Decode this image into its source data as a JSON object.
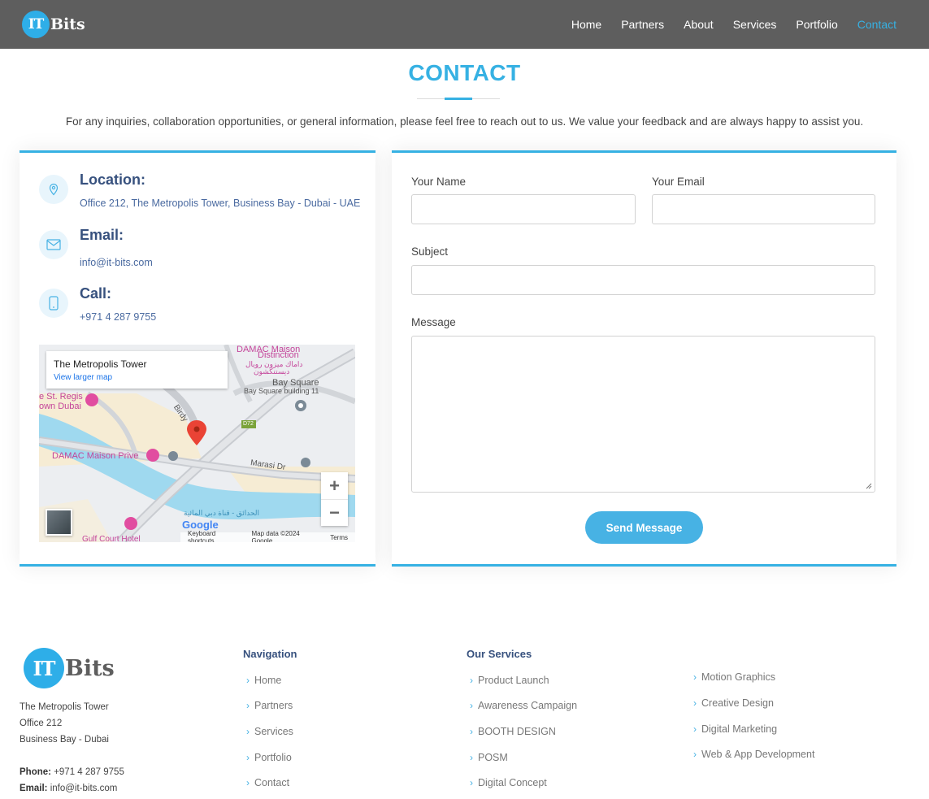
{
  "header": {
    "logo_badge": "IT",
    "logo_word": "Bits",
    "nav": [
      {
        "label": "Home"
      },
      {
        "label": "Partners"
      },
      {
        "label": "About"
      },
      {
        "label": "Services"
      },
      {
        "label": "Portfolio"
      },
      {
        "label": "Contact",
        "active": true
      }
    ]
  },
  "section": {
    "title": "CONTACT",
    "intro": "For any inquiries, collaboration opportunities, or general information, please feel free to reach out to us. We value your feedback and are always happy to assist you."
  },
  "info": {
    "location_title": "Location:",
    "location_text": "Office 212, The Metropolis Tower, Business Bay - Dubai - UAE",
    "email_title": "Email:",
    "email_text": "info@it-bits.com",
    "call_title": "Call:",
    "call_text": "+971 4 287 9755"
  },
  "map": {
    "place_title": "The Metropolis Tower",
    "larger_map": "View larger map",
    "labels": {
      "damac_distinction": "DAMAC Maison",
      "damac_distinction_2": "Distinction",
      "damac_arabic": "داماك ميزون رويال",
      "damac_arabic_2": "ديستنكشون",
      "bay_square": "Bay Square",
      "bay_square_building": "Bay Square building 11",
      "st_regis": "e St. Regis",
      "st_regis_2": "own Dubai",
      "birdy": "Birdy",
      "d72": "D72",
      "damac_prive": "DAMAC Maison Prive",
      "marasi": "Marasi Dr",
      "arabic_canal": "الحدائق - قناة دبي المائية",
      "gulf_court": "Gulf Court Hotel"
    },
    "zoom_in": "+",
    "zoom_out": "−",
    "google": "Google",
    "footer_shortcuts": "Keyboard shortcuts",
    "footer_data": "Map data ©2024 Google",
    "footer_terms": "Terms"
  },
  "form": {
    "name_label": "Your Name",
    "email_label": "Your Email",
    "subject_label": "Subject",
    "message_label": "Message",
    "send_label": "Send Message"
  },
  "footer": {
    "logo_badge": "IT",
    "logo_word": "Bits",
    "address_line1": "The Metropolis Tower",
    "address_line2": "Office 212",
    "address_line3": "Business Bay - Dubai",
    "phone_label": "Phone:",
    "phone_value": "+971 4 287 9755",
    "email_label": "Email:",
    "email_value": "info@it-bits.com",
    "nav_heading": "Navigation",
    "nav_links": [
      "Home",
      "Partners",
      "Services",
      "Portfolio",
      "Contact"
    ],
    "services_heading": "Our Services",
    "services_links": [
      "Product Launch",
      "Awareness Campaign",
      "BOOTH DESIGN",
      "POSM",
      "Digital Concept"
    ],
    "services_links_2": [
      "Motion Graphics",
      "Creative Design",
      "Digital Marketing",
      "Web & App Development"
    ]
  },
  "colors": {
    "accent": "#36b1e3",
    "header_bg": "#5e5e5e",
    "heading_navy": "#37517e",
    "button": "#47b2e4"
  }
}
